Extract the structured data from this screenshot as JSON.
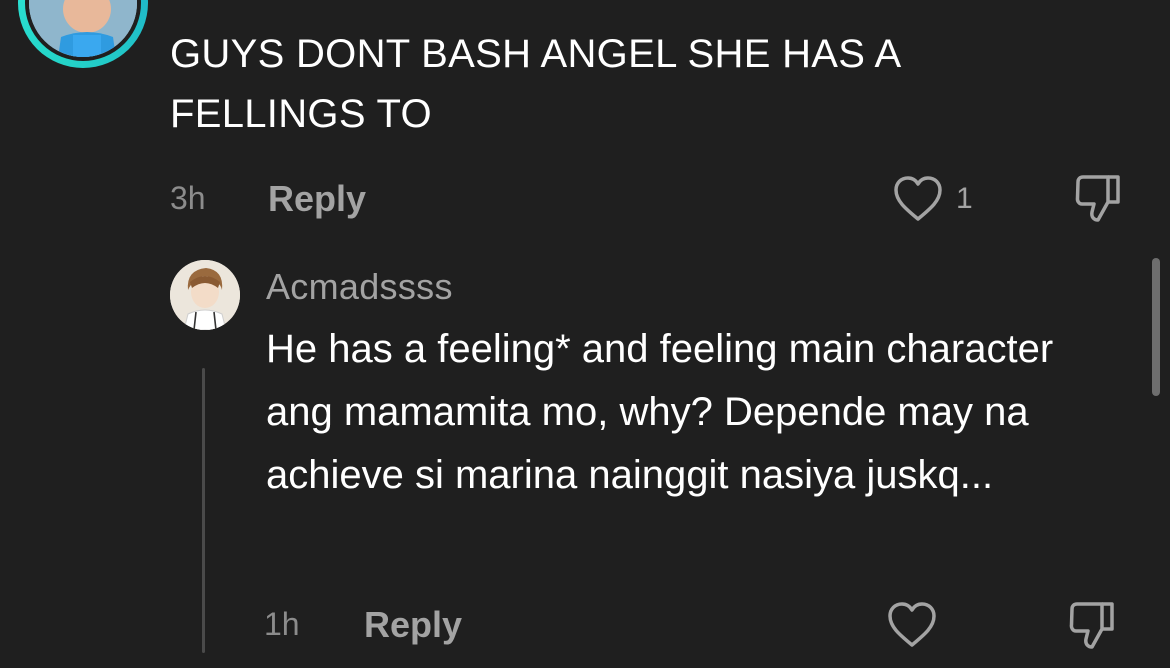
{
  "comment": {
    "text": "GUYS DONT BASH ANGEL SHE HAS A FELLINGS TO",
    "time": "3h",
    "reply_label": "Reply",
    "like_count": "1"
  },
  "reply": {
    "username": "Acmadssss",
    "text": "He has a feeling* and feeling main character ang mamamita mo, why? Depende may na achieve si marina nainggit nasiya juskq...",
    "time": "1h",
    "reply_label": "Reply"
  },
  "icons": {
    "like": "heart-outline-icon",
    "dislike": "thumbs-down-icon"
  },
  "colors": {
    "background": "#1f1f1f",
    "accent_ring": "#24d4c8",
    "muted_text": "#a3a3a3"
  }
}
